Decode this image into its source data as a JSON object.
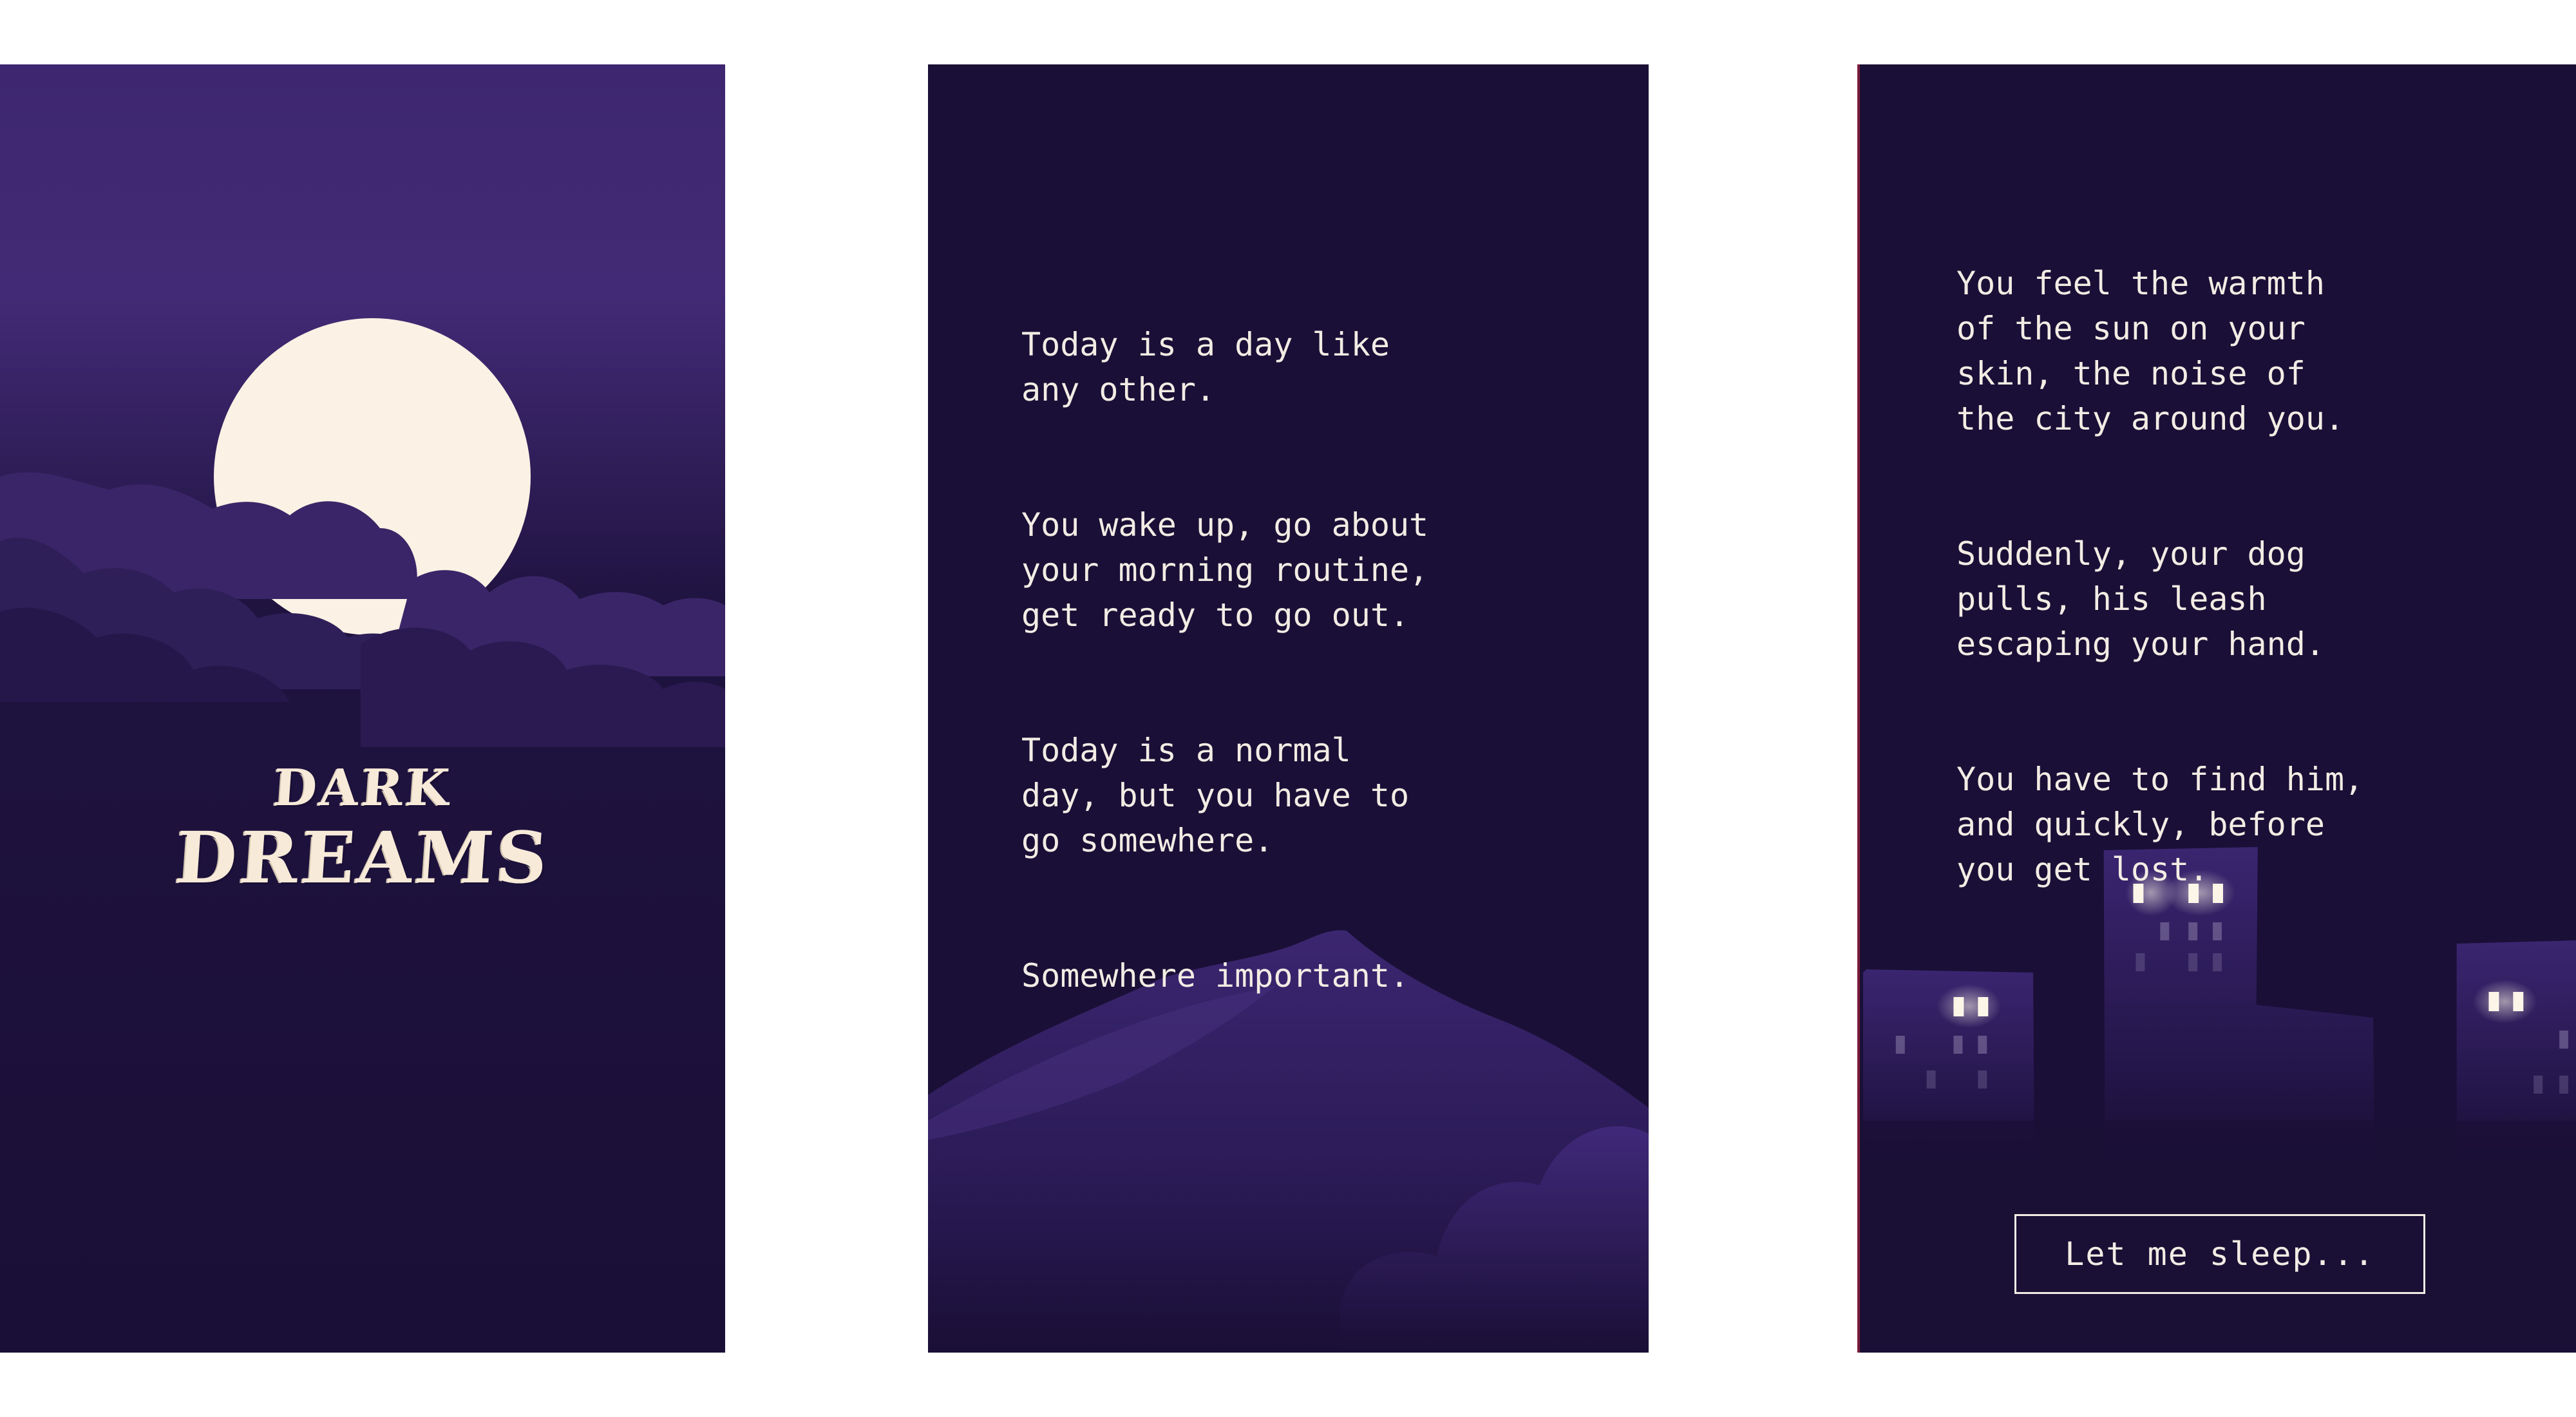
{
  "title": {
    "line1": "DARK",
    "line2": "DREAMS"
  },
  "screen2": {
    "paragraphs": [
      "Today is a day like\nany other.",
      "You wake up, go about\nyour morning routine,\nget ready to go out.",
      "Today is a normal\nday, but you have to\ngo somewhere.",
      "Somewhere important."
    ]
  },
  "screen3": {
    "paragraphs": [
      "You feel the warmth\nof the sun on your\nskin, the noise of\nthe city around you.",
      "Suddenly, your dog\npulls, his leash\nescaping your hand.",
      "You have to find him,\nand quickly, before\nyou get lost."
    ],
    "button_label": "Let me sleep..."
  },
  "colors": {
    "background": "#1a0f36",
    "sky_top": "#43296f",
    "moon": "#fbf1e4",
    "text": "#f2ece4",
    "window_light": "#fdf6e8",
    "accent_edge": "#7a1b3a"
  },
  "icons": [
    "moon-icon",
    "clouds-icon",
    "mountain-icon",
    "city-skyline-icon"
  ]
}
